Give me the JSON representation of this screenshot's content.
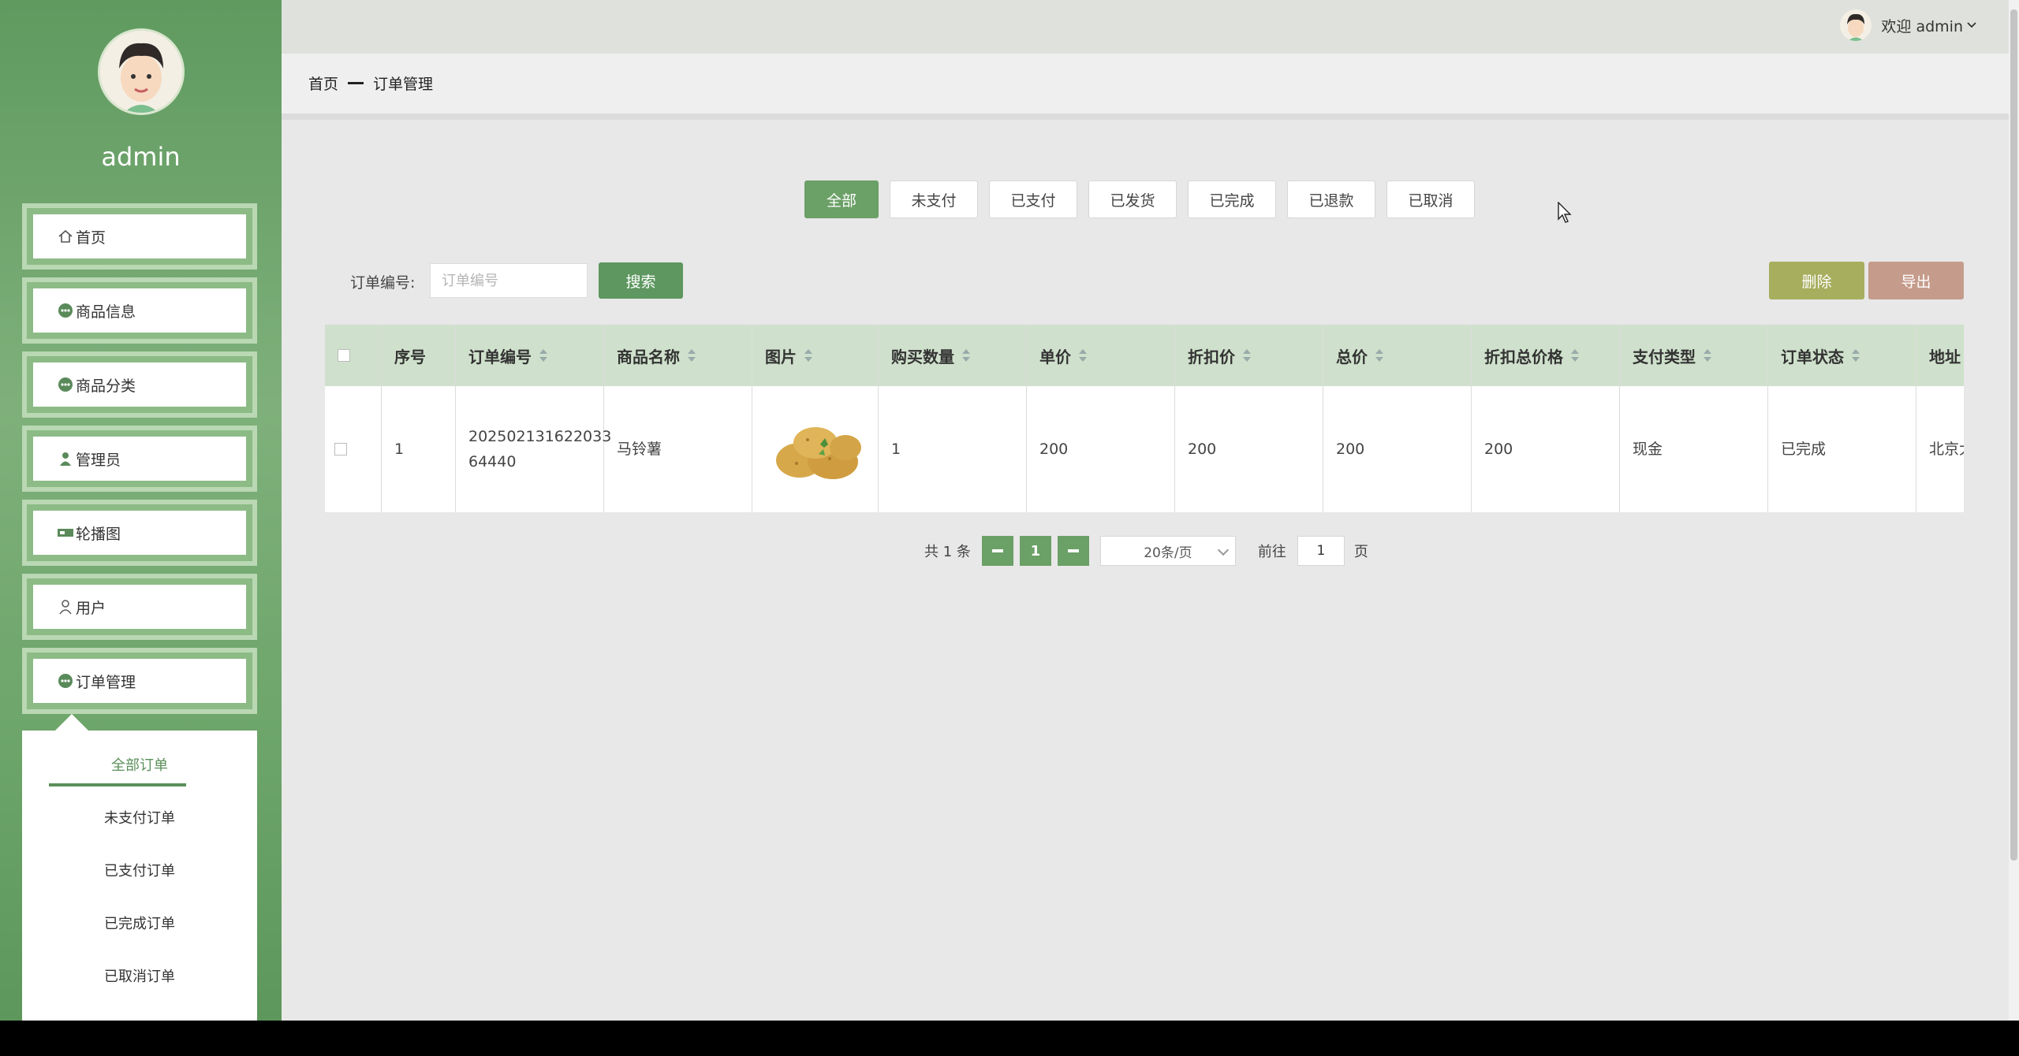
{
  "sidebar": {
    "username": "admin",
    "menu": [
      {
        "label": "首页",
        "icon": "home-icon"
      },
      {
        "label": "商品信息",
        "icon": "dots-circle-icon"
      },
      {
        "label": "商品分类",
        "icon": "dots-circle-icon"
      },
      {
        "label": "管理员",
        "icon": "person-icon"
      },
      {
        "label": "轮播图",
        "icon": "carousel-icon"
      },
      {
        "label": "用户",
        "icon": "user-icon"
      },
      {
        "label": "订单管理",
        "icon": "dots-circle-icon"
      }
    ],
    "submenu": [
      {
        "label": "全部订单",
        "active": true
      },
      {
        "label": "未支付订单"
      },
      {
        "label": "已支付订单"
      },
      {
        "label": "已完成订单"
      },
      {
        "label": "已取消订单"
      }
    ]
  },
  "topbar": {
    "welcome": "欢迎 admin"
  },
  "breadcrumb": {
    "home": "首页",
    "current": "订单管理"
  },
  "status_tabs": [
    "全部",
    "未支付",
    "已支付",
    "已发货",
    "已完成",
    "已退款",
    "已取消"
  ],
  "search": {
    "label": "订单编号:",
    "placeholder": "订单编号",
    "button": "搜索"
  },
  "actions": {
    "delete": "删除",
    "export": "导出"
  },
  "table": {
    "columns": [
      "序号",
      "订单编号",
      "商品名称",
      "图片",
      "购买数量",
      "单价",
      "折扣价",
      "总价",
      "折扣总价格",
      "支付类型",
      "订单状态",
      "地址"
    ],
    "rows": [
      {
        "index": "1",
        "order_no_line1": "202502131622033",
        "order_no_line2": "64440",
        "product": "马铃薯",
        "qty": "1",
        "price": "200",
        "discount_price": "200",
        "total": "200",
        "discount_total": "200",
        "pay_type": "现金",
        "status": "已完成",
        "address": "北京大"
      }
    ]
  },
  "pagination": {
    "total": "共 1 条",
    "page": "1",
    "page_size": "20条/页",
    "goto_label": "前往",
    "goto_value": "1",
    "page_suffix": "页"
  },
  "colors": {
    "accent": "#6ba066",
    "header_bg": "#cfe1cc",
    "delete": "#a7ae5e",
    "export": "#c59b8b"
  }
}
